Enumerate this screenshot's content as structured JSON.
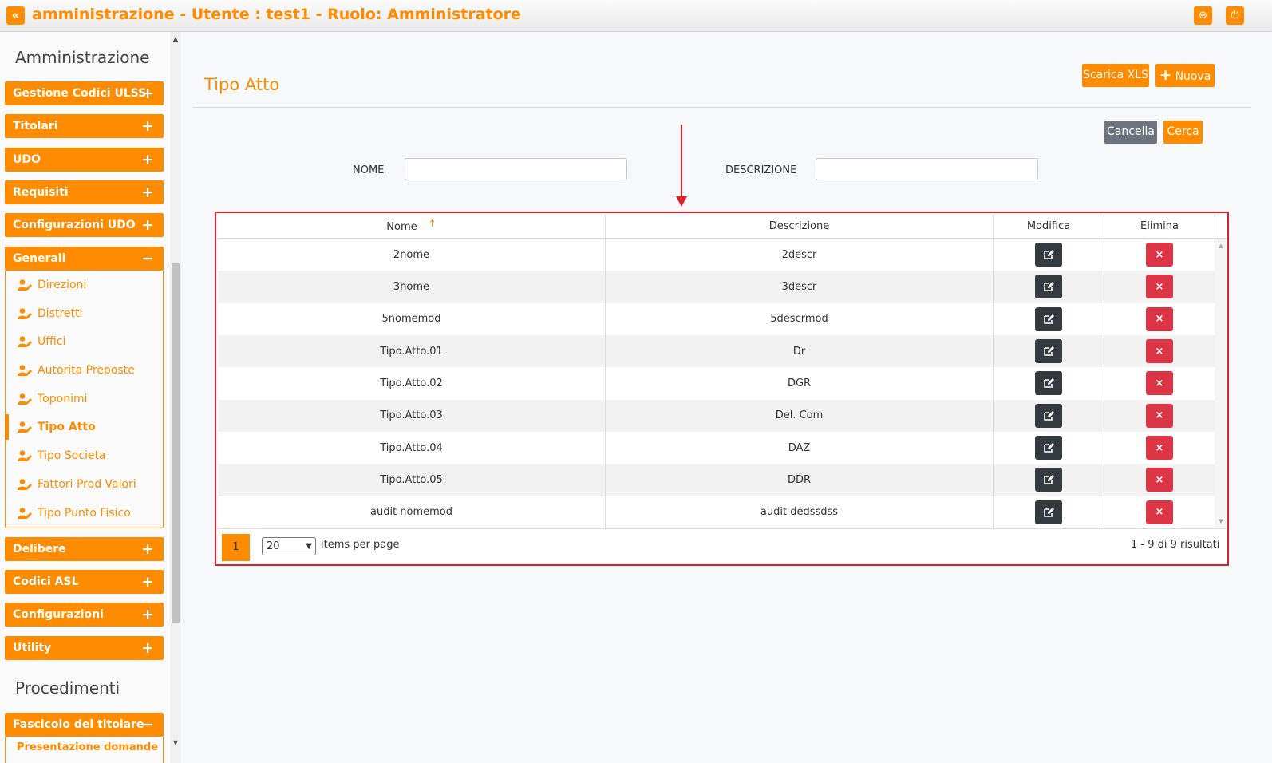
{
  "topbar": {
    "collapse_symbol": "«",
    "title": "amministrazione - Utente : test1 - Ruolo: Amministratore",
    "globe_symbol": "⊕",
    "power_symbol": "⏻"
  },
  "sidebar": {
    "heading_admin": "Amministrazione",
    "groups": [
      {
        "label": "Gestione Codici ULSS",
        "sign": "+"
      },
      {
        "label": "Titolari",
        "sign": "+"
      },
      {
        "label": "UDO",
        "sign": "+"
      },
      {
        "label": "Requisiti",
        "sign": "+"
      },
      {
        "label": "Configurazioni UDO",
        "sign": "+"
      },
      {
        "label": "Generali",
        "sign": "−"
      }
    ],
    "generali_items": [
      {
        "label": "Direzioni"
      },
      {
        "label": "Distretti"
      },
      {
        "label": "Uffici"
      },
      {
        "label": "Autorita Preposte"
      },
      {
        "label": "Toponimi"
      },
      {
        "label": "Tipo Atto"
      },
      {
        "label": "Tipo Societa"
      },
      {
        "label": "Fattori Prod Valori"
      },
      {
        "label": "Tipo Punto Fisico"
      }
    ],
    "groups_after": [
      {
        "label": "Delibere",
        "sign": "+"
      },
      {
        "label": "Codici ASL",
        "sign": "+"
      },
      {
        "label": "Configurazioni",
        "sign": "+"
      },
      {
        "label": "Utility",
        "sign": "+"
      }
    ],
    "heading_proc": "Procedimenti",
    "proc_group": {
      "label": "Fascicolo del titolare",
      "sign": "−"
    },
    "proc_item_partial": "Presentazione domande",
    "scroll_up": "▲",
    "scroll_down": "▼"
  },
  "main": {
    "page_title": "Tipo Atto",
    "export_label": "Scarica XLS",
    "new_label": "Nuova",
    "new_plus": "+",
    "clear_label": "Cancella",
    "search_label": "Cerca",
    "filter_nome_label": "NOME",
    "filter_nome_value": "",
    "filter_descr_label": "DESCRIZIONE",
    "filter_descr_value": ""
  },
  "grid": {
    "columns": [
      "Nome",
      "Descrizione",
      "Modifica",
      "Elimina"
    ],
    "sort_symbol": "↑",
    "rows": [
      {
        "nome": "2nome",
        "descrizione": "2descr"
      },
      {
        "nome": "3nome",
        "descrizione": "3descr"
      },
      {
        "nome": "5nomemod",
        "descrizione": "5descrmod"
      },
      {
        "nome": "Tipo.Atto.01",
        "descrizione": "Dr"
      },
      {
        "nome": "Tipo.Atto.02",
        "descrizione": "DGR"
      },
      {
        "nome": "Tipo.Atto.03",
        "descrizione": "Del. Com"
      },
      {
        "nome": "Tipo.Atto.04",
        "descrizione": "DAZ"
      },
      {
        "nome": "Tipo.Atto.05",
        "descrizione": "DDR"
      },
      {
        "nome": "audit nomemod",
        "descrizione": "audit dedssdss"
      }
    ],
    "delete_symbol": "×",
    "scroll_up": "▲",
    "scroll_down": "▼",
    "pager": {
      "current_page": "1",
      "page_size": "20",
      "dropdown_symbol": "▼",
      "items_per_page": "items per page",
      "results": "1 - 9 di 9 risultati"
    }
  },
  "colors": {
    "accent": "#ff8c00",
    "annotation": "#e0202a",
    "edit_button": "#343a40",
    "delete_button": "#dc3545",
    "clear_button": "#6c757d"
  }
}
